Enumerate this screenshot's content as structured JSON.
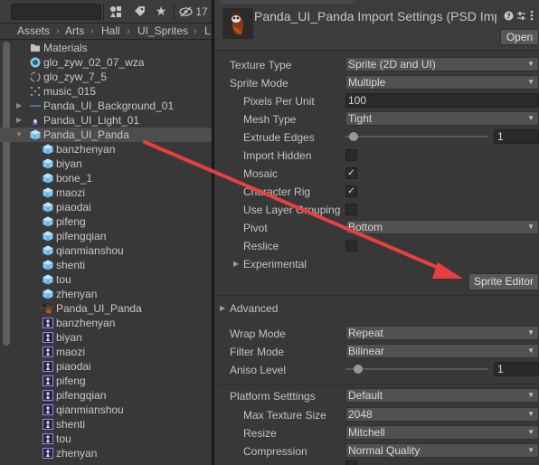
{
  "project": {
    "toolbar": {
      "hidden_count": "17"
    },
    "breadcrumbs": [
      "Assets",
      "Arts",
      "Hall",
      "UI_Sprites",
      "L"
    ],
    "items": [
      {
        "label": "Materials"
      },
      {
        "label": "glo_zyw_02_07_wza"
      },
      {
        "label": "glo_zyw_7_5"
      },
      {
        "label": "music_015"
      },
      {
        "label": "Panda_UI_Background_01"
      },
      {
        "label": "Panda_UI_Light_01"
      },
      {
        "label": "Panda_UI_Panda"
      },
      {
        "label": "banzhenyan"
      },
      {
        "label": "biyan"
      },
      {
        "label": "bone_1"
      },
      {
        "label": "maozi"
      },
      {
        "label": "piaodai"
      },
      {
        "label": "pifeng"
      },
      {
        "label": "pifengqian"
      },
      {
        "label": "qianmianshou"
      },
      {
        "label": "shenti"
      },
      {
        "label": "tou"
      },
      {
        "label": "zhenyan"
      },
      {
        "label": "Panda_UI_Panda"
      },
      {
        "label": "banzhenyan"
      },
      {
        "label": "biyan"
      },
      {
        "label": "maozi"
      },
      {
        "label": "piaodai"
      },
      {
        "label": "pifeng"
      },
      {
        "label": "pifengqian"
      },
      {
        "label": "qianmianshou"
      },
      {
        "label": "shenti"
      },
      {
        "label": "tou"
      },
      {
        "label": "zhenyan"
      }
    ]
  },
  "inspector": {
    "title": "Panda_UI_Panda Import Settings (PSD Impo",
    "open_label": "Open",
    "texture_type": {
      "label": "Texture Type",
      "value": "Sprite (2D and UI)"
    },
    "sprite_mode": {
      "label": "Sprite Mode",
      "value": "Multiple"
    },
    "pixels_per_unit": {
      "label": "Pixels Per Unit",
      "value": "100"
    },
    "mesh_type": {
      "label": "Mesh Type",
      "value": "Tight"
    },
    "extrude_edges": {
      "label": "Extrude Edges",
      "value": "1"
    },
    "import_hidden": {
      "label": "Import Hidden"
    },
    "mosaic": {
      "label": "Mosaic"
    },
    "character_rig": {
      "label": "Character Rig"
    },
    "use_layer_grouping": {
      "label": "Use Layer Grouping"
    },
    "pivot": {
      "label": "Pivot",
      "value": "Bottom"
    },
    "reslice": {
      "label": "Reslice"
    },
    "experimental": {
      "label": "Experimental"
    },
    "sprite_editor_label": "Sprite Editor",
    "advanced": {
      "label": "Advanced"
    },
    "wrap_mode": {
      "label": "Wrap Mode",
      "value": "Repeat"
    },
    "filter_mode": {
      "label": "Filter Mode",
      "value": "Bilinear"
    },
    "aniso_level": {
      "label": "Aniso Level",
      "value": "1"
    },
    "platform_settings": {
      "label": "Platform Setttings",
      "value": "Default"
    },
    "max_texture_size": {
      "label": "Max Texture Size",
      "value": "2048"
    },
    "resize": {
      "label": "Resize",
      "value": "Mitchell"
    },
    "compression": {
      "label": "Compression",
      "value": "Normal Quality"
    }
  },
  "colors": {
    "accent_arrow": "#e84040",
    "selection": "#4d4d4d",
    "sprite_cube": "#7ec8f0"
  }
}
